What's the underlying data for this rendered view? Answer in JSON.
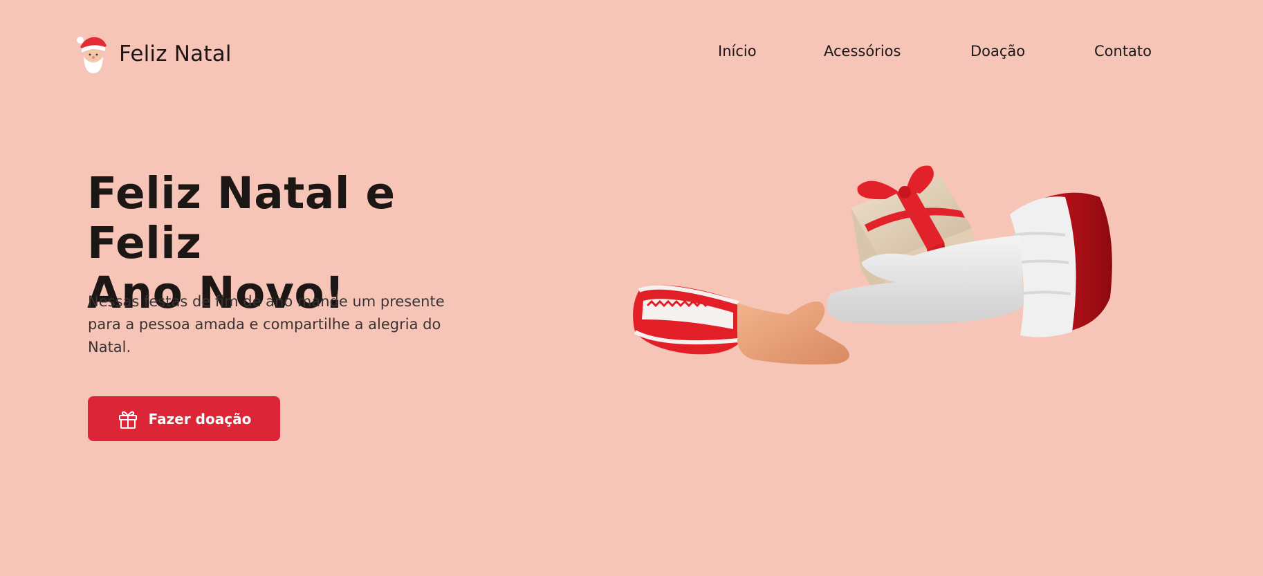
{
  "header": {
    "logo_text": "Feliz Natal",
    "logo_icon": "santa-icon",
    "nav": [
      {
        "label": "Início"
      },
      {
        "label": "Acessórios"
      },
      {
        "label": "Doação"
      },
      {
        "label": "Contato"
      }
    ]
  },
  "hero": {
    "title_line1": "Feliz Natal e Feliz",
    "title_line2": "Ano Novo!",
    "text": "Nessas festas de fim de ano mande um presente para a pessoa amada e compartilhe a alegria do Natal.",
    "cta_label": "Fazer doação",
    "cta_icon": "gift-icon",
    "illustration": "hands-exchanging-gift-image"
  },
  "colors": {
    "background": "#f6c5b8",
    "accent": "#dc2637",
    "text": "#1c1615"
  }
}
